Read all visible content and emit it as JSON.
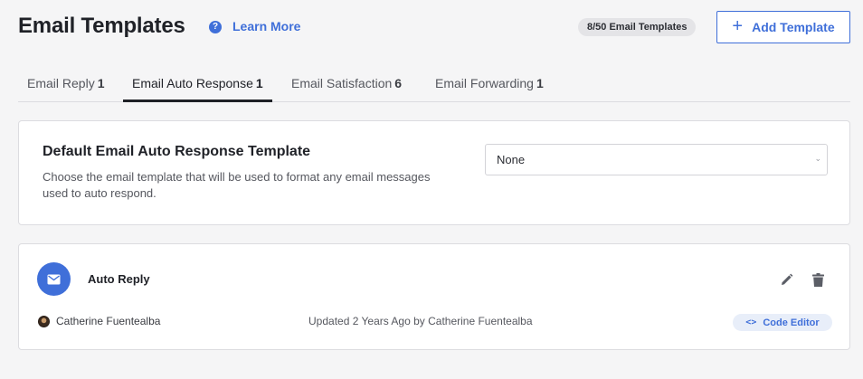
{
  "header": {
    "title": "Email Templates",
    "learn_more": "Learn More",
    "template_count": "8/50 Email Templates",
    "add_button": "Add Template"
  },
  "tabs": [
    {
      "label": "Email Reply",
      "count": "1",
      "active": false
    },
    {
      "label": "Email Auto Response",
      "count": "1",
      "active": true
    },
    {
      "label": "Email Satisfaction",
      "count": "6",
      "active": false
    },
    {
      "label": "Email Forwarding",
      "count": "1",
      "active": false
    }
  ],
  "default_template": {
    "title": "Default Email Auto Response Template",
    "description": "Choose the email template that will be used to format any email messages used to auto respond.",
    "selected": "None"
  },
  "templates": [
    {
      "name": "Auto Reply",
      "author": "Catherine Fuentealba",
      "updated": "Updated 2 Years Ago by Catherine Fuentealba",
      "code_editor": "Code Editor"
    }
  ],
  "colors": {
    "accent": "#3f6fd9",
    "background": "#f5f5f6",
    "badge_bg": "#e4e4e7",
    "code_btn_bg": "#e8eef9"
  },
  "icons": {
    "help": "help-icon",
    "add": "plus-icon",
    "select": "chevron-down-icon",
    "template": "envelope-icon",
    "edit": "pencil-icon",
    "delete": "trash-icon",
    "code": "code-icon"
  }
}
